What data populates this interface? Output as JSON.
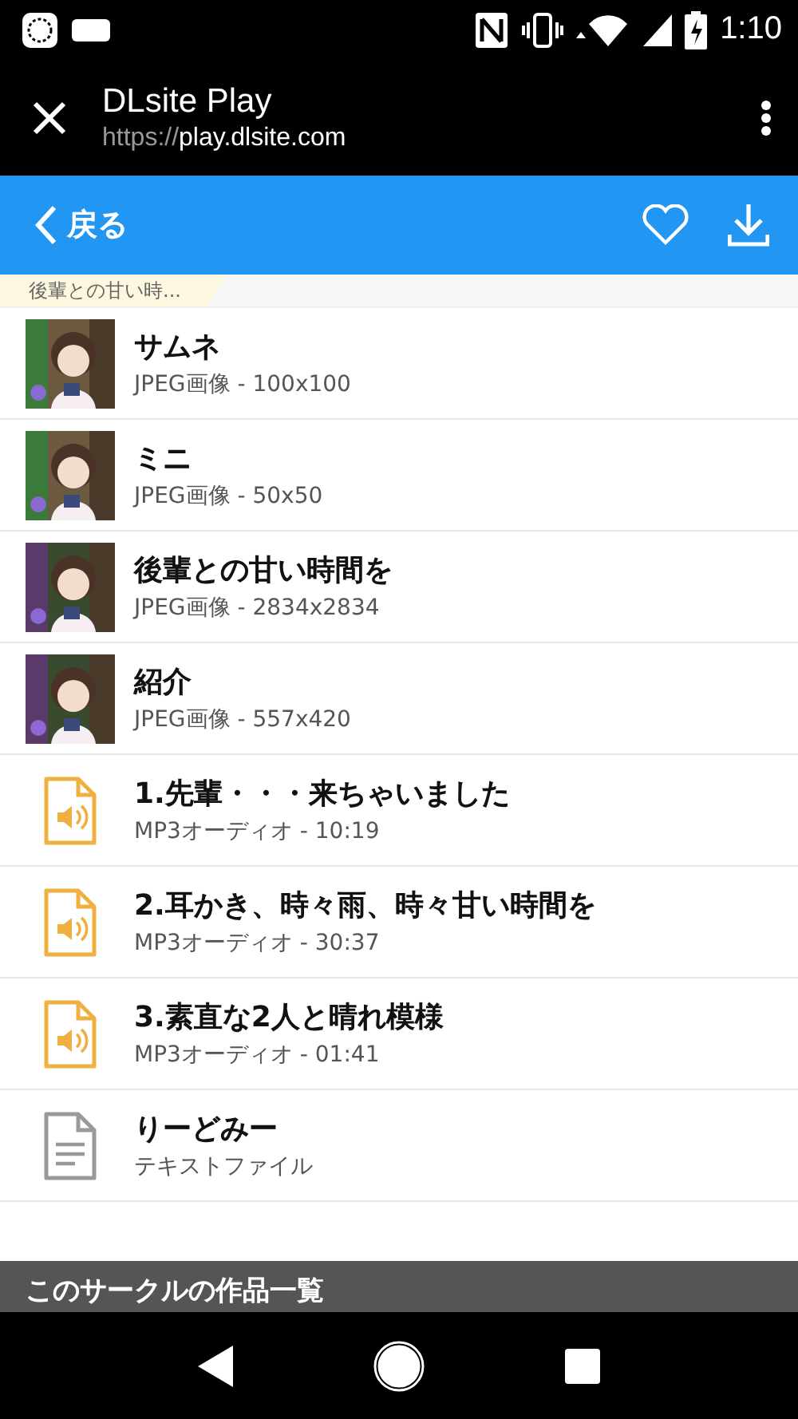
{
  "status_bar": {
    "time": "1:10"
  },
  "browser_bar": {
    "title": "DLsite Play",
    "url_scheme": "https://",
    "url_host": "play.dlsite.com"
  },
  "app_bar": {
    "back_label": "戻る"
  },
  "breadcrumb": {
    "label": "後輩との甘い時..."
  },
  "files": [
    {
      "name": "サムネ",
      "detail": "JPEG画像 - 100x100"
    },
    {
      "name": "ミニ",
      "detail": "JPEG画像 - 50x50"
    },
    {
      "name": "後輩との甘い時間を",
      "detail": "JPEG画像 - 2834x2834"
    },
    {
      "name": "紹介",
      "detail": "JPEG画像 - 557x420"
    },
    {
      "kind": "audio",
      "name": "1.先輩・・・来ちゃいました",
      "detail": "MP3オーディオ - 10:19"
    },
    {
      "kind": "audio",
      "name": "2.耳かき、時々雨、時々甘い時間を",
      "detail": "MP3オーディオ - 30:37"
    },
    {
      "kind": "audio",
      "name": "3.素直な2人と晴れ模様",
      "detail": "MP3オーディオ - 01:41"
    },
    {
      "kind": "text",
      "name": "りーどみー",
      "detail": "テキストファイル"
    }
  ],
  "section": {
    "title": "このサークルの作品一覧"
  }
}
